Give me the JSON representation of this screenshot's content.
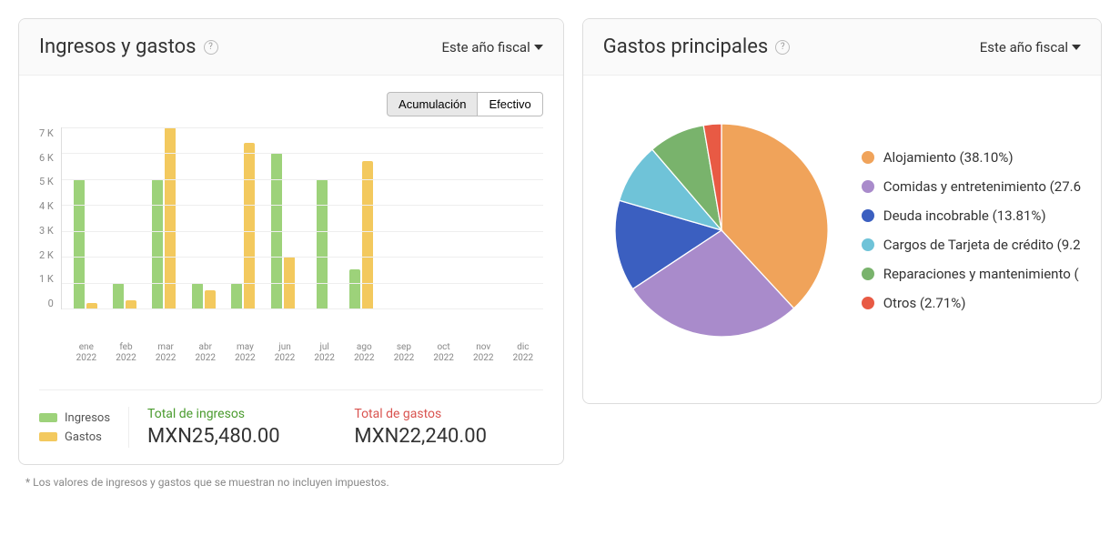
{
  "income_expense_card": {
    "title": "Ingresos y gastos",
    "period_label": "Este año fiscal",
    "toggle_accrual": "Acumulación",
    "toggle_cash": "Efectivo",
    "legend_income": "Ingresos",
    "legend_expense": "Gastos",
    "total_income_label": "Total de ingresos",
    "total_income_value": "MXN25,480.00",
    "total_expense_label": "Total de gastos",
    "total_expense_value": "MXN22,240.00"
  },
  "top_expenses_card": {
    "title": "Gastos principales",
    "period_label": "Este año fiscal"
  },
  "footnote": "* Los valores de ingresos y gastos que se muestran no incluyen impuestos.",
  "chart_data": [
    {
      "type": "bar",
      "title": "Ingresos y gastos",
      "ylabel": "",
      "ylim": [
        0,
        7000
      ],
      "y_ticks": [
        "7 K",
        "6 K",
        "5 K",
        "4 K",
        "3 K",
        "2 K",
        "1 K",
        "0"
      ],
      "categories": [
        {
          "month": "ene",
          "year": "2022"
        },
        {
          "month": "feb",
          "year": "2022"
        },
        {
          "month": "mar",
          "year": "2022"
        },
        {
          "month": "abr",
          "year": "2022"
        },
        {
          "month": "may",
          "year": "2022"
        },
        {
          "month": "jun",
          "year": "2022"
        },
        {
          "month": "jul",
          "year": "2022"
        },
        {
          "month": "ago",
          "year": "2022"
        },
        {
          "month": "sep",
          "year": "2022"
        },
        {
          "month": "oct",
          "year": "2022"
        },
        {
          "month": "nov",
          "year": "2022"
        },
        {
          "month": "dic",
          "year": "2022"
        }
      ],
      "series": [
        {
          "name": "Ingresos",
          "color": "#9dd27a",
          "values": [
            5000,
            1000,
            5000,
            1000,
            1000,
            6000,
            5000,
            1500,
            0,
            0,
            0,
            0
          ]
        },
        {
          "name": "Gastos",
          "color": "#f3c95e",
          "values": [
            200,
            300,
            7000,
            700,
            6400,
            2000,
            0,
            5700,
            0,
            0,
            0,
            0
          ]
        }
      ]
    },
    {
      "type": "pie",
      "title": "Gastos principales",
      "slices": [
        {
          "label": "Alojamiento",
          "percent": 38.1,
          "color": "#f0a35a",
          "legend_text": "Alojamiento (38.10%)"
        },
        {
          "label": "Comidas y entretenimiento",
          "percent": 27.6,
          "color": "#a98bcb",
          "legend_text": "Comidas y entretenimiento (27.6"
        },
        {
          "label": "Deuda incobrable",
          "percent": 13.81,
          "color": "#3b5fc0",
          "legend_text": "Deuda incobrable (13.81%)"
        },
        {
          "label": "Cargos de Tarjeta de crédito",
          "percent": 9.2,
          "color": "#6fc3d8",
          "legend_text": "Cargos de Tarjeta de crédito (9.2"
        },
        {
          "label": "Reparaciones y mantenimiento",
          "percent": 8.58,
          "color": "#79b36c",
          "legend_text": "Reparaciones y mantenimiento ("
        },
        {
          "label": "Otros",
          "percent": 2.71,
          "color": "#e85a44",
          "legend_text": "Otros (2.71%)"
        }
      ]
    }
  ]
}
